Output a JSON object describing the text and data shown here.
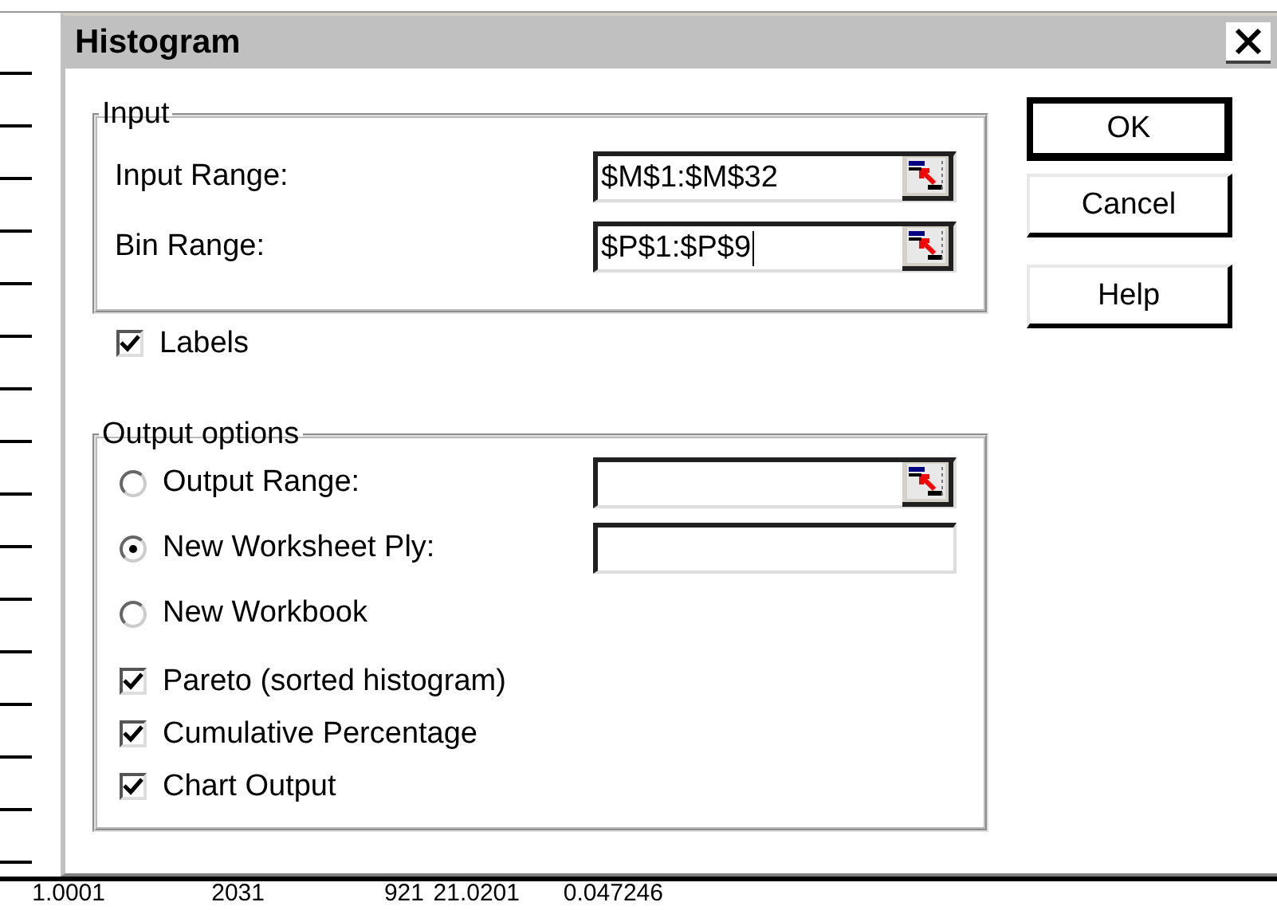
{
  "window": {
    "title": "Histogram"
  },
  "input_group": {
    "title": "Input",
    "fields": [
      {
        "label": "Input Range:",
        "value": "$M$1:$M$32",
        "focused": false
      },
      {
        "label": "Bin Range:",
        "value": "$P$1:$P$9",
        "focused": true
      }
    ]
  },
  "labels_checkbox": {
    "label": "Labels",
    "checked": true
  },
  "output_group": {
    "title": "Output options",
    "options": [
      {
        "label": "Output Range:",
        "selected": false,
        "field": {
          "picker": true
        }
      },
      {
        "label": "New Worksheet Ply:",
        "selected": true,
        "field": {
          "picker": false
        }
      },
      {
        "label": "New Workbook",
        "selected": false
      }
    ],
    "checkboxes": [
      {
        "label": "Pareto (sorted histogram)",
        "checked": true
      },
      {
        "label": "Cumulative Percentage",
        "checked": true
      },
      {
        "label": "Chart Output",
        "checked": true
      }
    ]
  },
  "buttons": [
    {
      "label": "OK",
      "default": true
    },
    {
      "label": "Cancel",
      "default": false
    },
    {
      "label": "Help",
      "default": false
    }
  ],
  "sheet_bottom_row": [
    "1.0001",
    "2031",
    "921",
    "21.0201",
    "0.047246"
  ]
}
